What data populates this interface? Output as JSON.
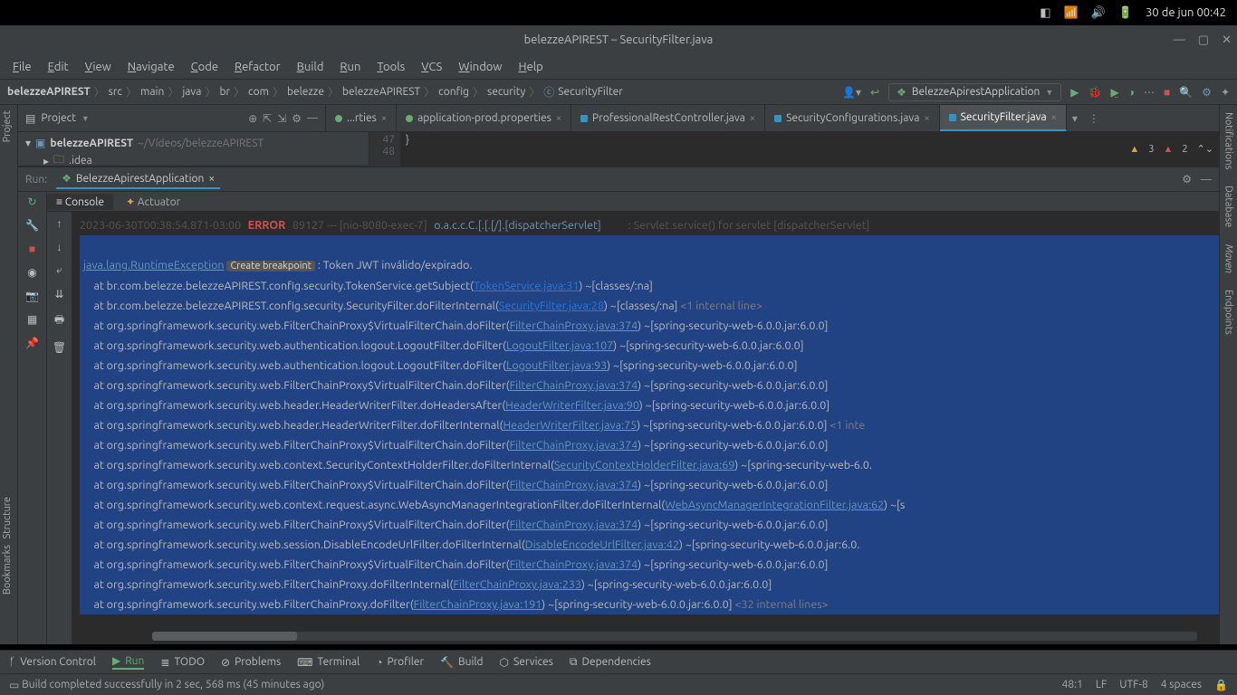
{
  "os_topbar": {
    "date": "30 de jun  00:42"
  },
  "window_title": "belezzeAPIREST – SecurityFilter.java",
  "menu": [
    "File",
    "Edit",
    "View",
    "Navigate",
    "Code",
    "Refactor",
    "Build",
    "Run",
    "Tools",
    "VCS",
    "Window",
    "Help"
  ],
  "breadcrumbs": [
    "belezzeAPIREST",
    "src",
    "main",
    "java",
    "br",
    "com",
    "belezze",
    "belezzeAPIREST",
    "config",
    "security",
    "SecurityFilter"
  ],
  "run_config": "BelezzeApirestApplication",
  "project_panel": {
    "title": "Project",
    "root": "belezzeAPIREST",
    "root_path": "~/Vídeos/belezzeAPIREST",
    "child": ".idea"
  },
  "editor_tabs": [
    {
      "label": "...rties",
      "icon": "green",
      "close": true,
      "partial": true
    },
    {
      "label": "application-prod.properties",
      "icon": "green",
      "close": true
    },
    {
      "label": "ProfessionalRestController.java",
      "icon": "blue",
      "close": true
    },
    {
      "label": "SecurityConfigurations.java",
      "icon": "blue",
      "close": true
    },
    {
      "label": "SecurityFilter.java",
      "icon": "blue",
      "close": true,
      "active": true
    }
  ],
  "gutter": [
    "47",
    "48"
  ],
  "editor_line47": "}",
  "warnings": {
    "warn_count": "3",
    "err_count": "2"
  },
  "run_panel": {
    "label": "Run:",
    "tab": "BelezzeApirestApplication",
    "sub_tabs": [
      "Console",
      "Actuator"
    ]
  },
  "console": {
    "header_line": {
      "ts": "2023-06-30T00:38:54.871-03:00",
      "level": "ERROR",
      "pid": "89127",
      "thread": "[nio-8080-exec-7]",
      "cls": "o.a.c.c.C.[.[.[/].[dispatcherServlet]",
      "msg": ": Servlet.service() for servlet [dispatcherServlet]"
    },
    "exception_class": "java.lang.RuntimeException",
    "create_bp": "Create breakpoint",
    "exception_msg": ": Token JWT inválido/expirado.",
    "frames": [
      {
        "txt": "at br.com.belezze.belezzeAPIREST.config.security.TokenService.getSubject(",
        "link": "TokenService.java:31",
        "blue": true,
        "tail": ") ~[classes/:na]"
      },
      {
        "txt": "at br.com.belezze.belezzeAPIREST.config.security.SecurityFilter.doFilterInternal(",
        "link": "SecurityFilter.java:28",
        "blue": true,
        "tail": ") ~[classes/:na] ",
        "extra": "<1 internal line>"
      },
      {
        "txt": "at org.springframework.security.web.FilterChainProxy$VirtualFilterChain.doFilter(",
        "link": "FilterChainProxy.java:374",
        "tail": ") ~[spring-security-web-6.0.0.jar:6.0.0]"
      },
      {
        "txt": "at org.springframework.security.web.authentication.logout.LogoutFilter.doFilter(",
        "link": "LogoutFilter.java:107",
        "tail": ") ~[spring-security-web-6.0.0.jar:6.0.0]"
      },
      {
        "txt": "at org.springframework.security.web.authentication.logout.LogoutFilter.doFilter(",
        "link": "LogoutFilter.java:93",
        "tail": ") ~[spring-security-web-6.0.0.jar:6.0.0]"
      },
      {
        "txt": "at org.springframework.security.web.FilterChainProxy$VirtualFilterChain.doFilter(",
        "link": "FilterChainProxy.java:374",
        "tail": ") ~[spring-security-web-6.0.0.jar:6.0.0]"
      },
      {
        "txt": "at org.springframework.security.web.header.HeaderWriterFilter.doHeadersAfter(",
        "link": "HeaderWriterFilter.java:90",
        "tail": ") ~[spring-security-web-6.0.0.jar:6.0.0]"
      },
      {
        "txt": "at org.springframework.security.web.header.HeaderWriterFilter.doFilterInternal(",
        "link": "HeaderWriterFilter.java:75",
        "tail": ") ~[spring-security-web-6.0.0.jar:6.0.0] ",
        "extra": "<1 inte"
      },
      {
        "txt": "at org.springframework.security.web.FilterChainProxy$VirtualFilterChain.doFilter(",
        "link": "FilterChainProxy.java:374",
        "tail": ") ~[spring-security-web-6.0.0.jar:6.0.0]"
      },
      {
        "txt": "at org.springframework.security.web.context.SecurityContextHolderFilter.doFilterInternal(",
        "link": "SecurityContextHolderFilter.java:69",
        "tail": ") ~[spring-security-web-6.0."
      },
      {
        "txt": "at org.springframework.security.web.FilterChainProxy$VirtualFilterChain.doFilter(",
        "link": "FilterChainProxy.java:374",
        "tail": ") ~[spring-security-web-6.0.0.jar:6.0.0]"
      },
      {
        "txt": "at org.springframework.security.web.context.request.async.WebAsyncManagerIntegrationFilter.doFilterInternal(",
        "link": "WebAsyncManagerIntegrationFilter.java:62",
        "tail": ") ~[s"
      },
      {
        "txt": "at org.springframework.security.web.FilterChainProxy$VirtualFilterChain.doFilter(",
        "link": "FilterChainProxy.java:374",
        "tail": ") ~[spring-security-web-6.0.0.jar:6.0.0]"
      },
      {
        "txt": "at org.springframework.security.web.session.DisableEncodeUrlFilter.doFilterInternal(",
        "link": "DisableEncodeUrlFilter.java:42",
        "tail": ") ~[spring-security-web-6.0.0.jar:6.0."
      },
      {
        "txt": "at org.springframework.security.web.FilterChainProxy$VirtualFilterChain.doFilter(",
        "link": "FilterChainProxy.java:374",
        "tail": ") ~[spring-security-web-6.0.0.jar:6.0.0]"
      },
      {
        "txt": "at org.springframework.security.web.FilterChainProxy.doFilterInternal(",
        "link": "FilterChainProxy.java:233",
        "tail": ") ~[spring-security-web-6.0.0.jar:6.0.0]"
      },
      {
        "txt": "at org.springframework.security.web.FilterChainProxy.doFilter(",
        "link": "FilterChainProxy.java:191",
        "tail": ") ~[spring-security-web-6.0.0.jar:6.0.0] ",
        "extra": "<32 internal lines>"
      }
    ]
  },
  "bottom_tools": [
    "Version Control",
    "Run",
    "TODO",
    "Problems",
    "Terminal",
    "Profiler",
    "Build",
    "Services",
    "Dependencies"
  ],
  "status_bar": {
    "msg": "Build completed successfully in 2 sec, 568 ms (45 minutes ago)",
    "caret": "48:1",
    "lf": "LF",
    "enc": "UTF-8",
    "indent": "4 spaces"
  },
  "left_tabs": [
    "Project",
    "Bookmarks",
    "Structure"
  ],
  "right_tabs": [
    "Notifications",
    "Database",
    "Maven",
    "Endpoints"
  ]
}
